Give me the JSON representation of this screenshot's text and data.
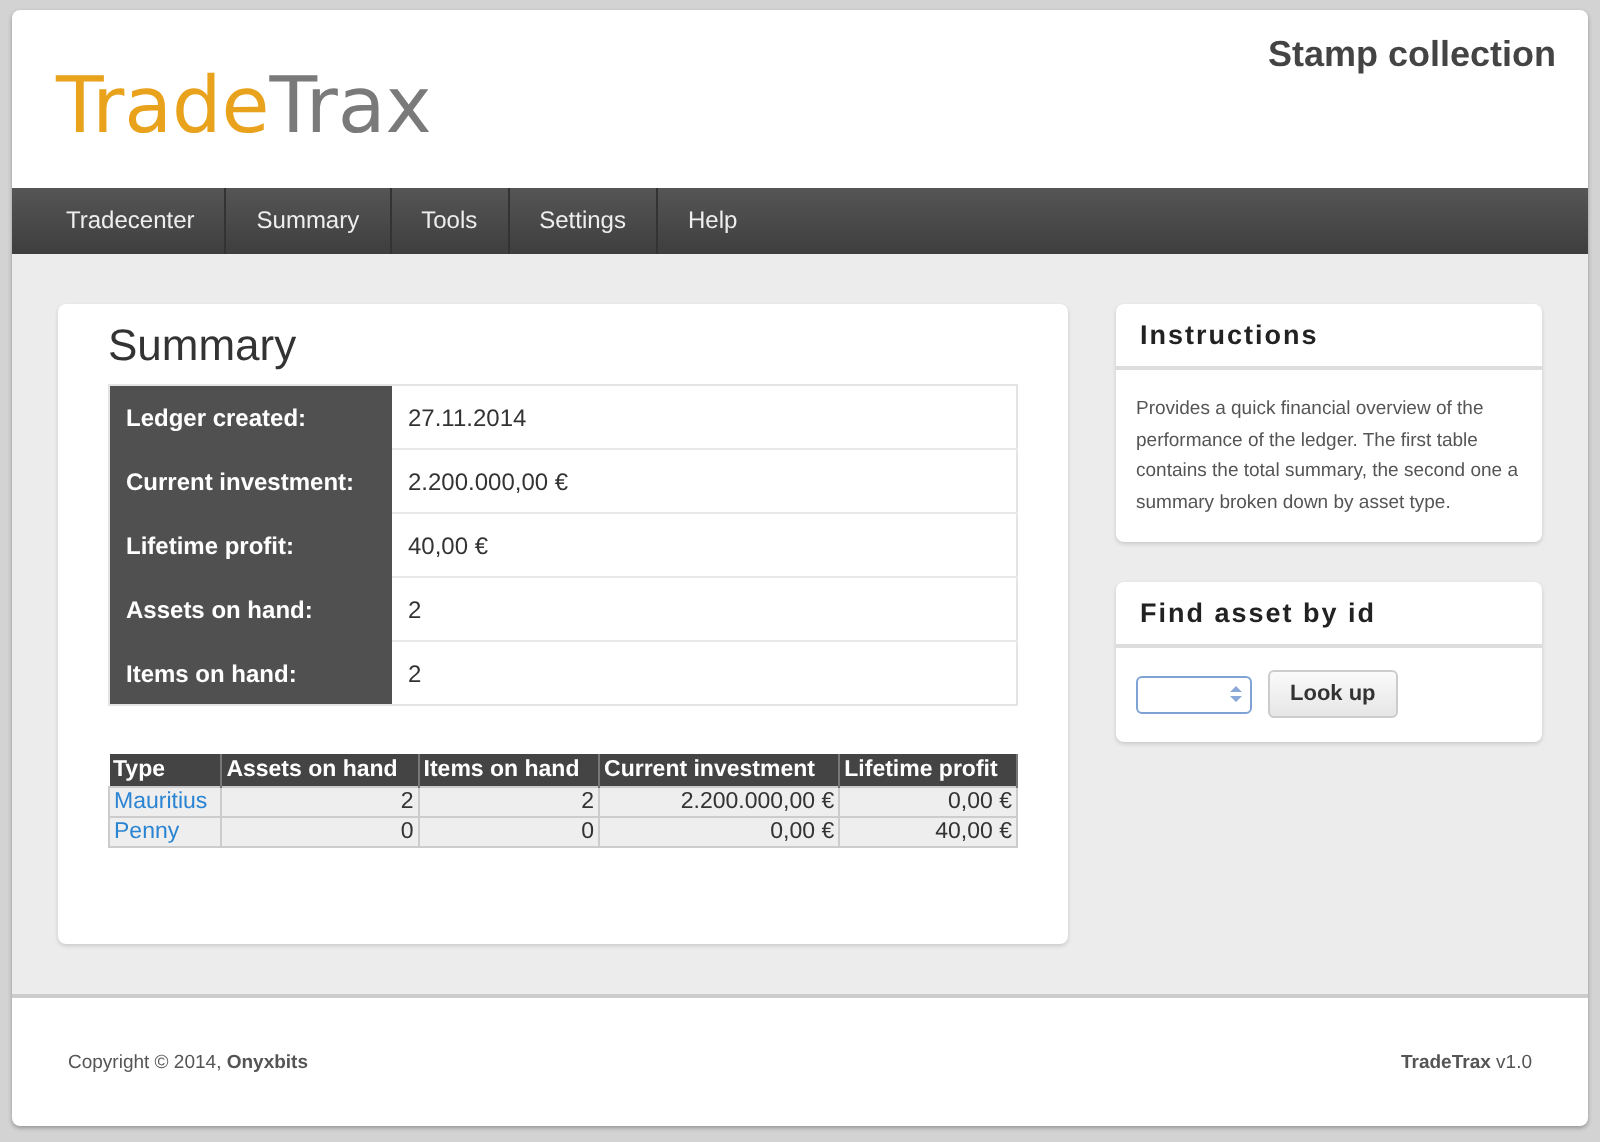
{
  "header": {
    "logo": {
      "part_1": "Trade",
      "part_2": "Trax"
    },
    "title": "Stamp collection"
  },
  "nav": [
    {
      "label": "Tradecenter"
    },
    {
      "label": "Summary"
    },
    {
      "label": "Tools"
    },
    {
      "label": "Settings"
    },
    {
      "label": "Help"
    }
  ],
  "summary": {
    "title": "Summary",
    "rows": [
      {
        "label": "Ledger created:",
        "value": "27.11.2014"
      },
      {
        "label": "Current investment:",
        "value": "2.200.000,00 €"
      },
      {
        "label": "Lifetime profit:",
        "value": "40,00 €"
      },
      {
        "label": "Assets on hand:",
        "value": "2"
      },
      {
        "label": "Items on hand:",
        "value": "2"
      }
    ],
    "table": {
      "columns": [
        "Type",
        "Assets on hand",
        "Items on hand",
        "Current investment",
        "Lifetime profit"
      ],
      "rows": [
        [
          "Mauritius",
          "2",
          "2",
          "2.200.000,00 €",
          "0,00 €"
        ],
        [
          "Penny",
          "0",
          "0",
          "0,00 €",
          "40,00 €"
        ]
      ]
    }
  },
  "instructions": {
    "title": "Instructions",
    "text": "Provides a quick financial overview of the performance of the ledger. The first table contains the total summary, the second one a summary broken down by asset type."
  },
  "find_asset": {
    "title": "Find asset by id",
    "button": "Look up"
  },
  "footer": {
    "copyright": "Copyright © 2014, **Onyxbits**",
    "product": "**TradeTrax** v1.0"
  }
}
